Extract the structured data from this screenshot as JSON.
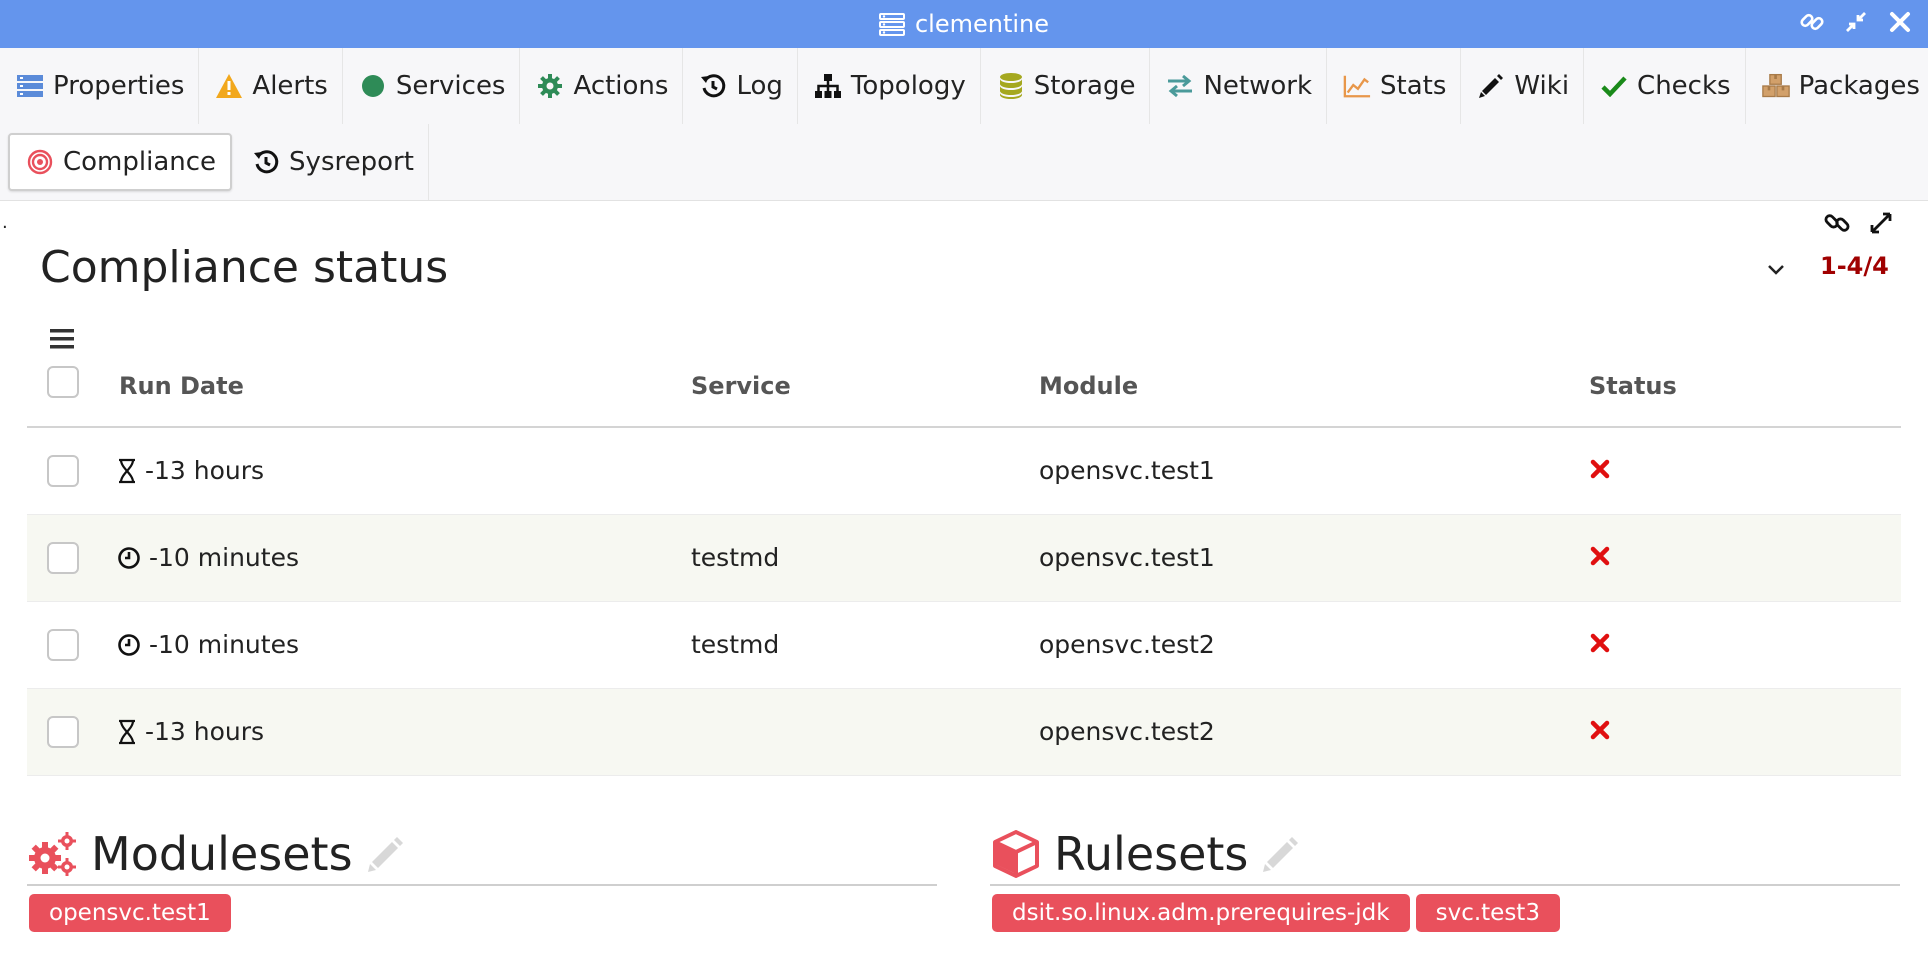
{
  "window": {
    "title": "clementine"
  },
  "tabs": [
    {
      "label": "Properties",
      "icon": "server-icon"
    },
    {
      "label": "Alerts",
      "icon": "warning-icon"
    },
    {
      "label": "Services",
      "icon": "circle-icon"
    },
    {
      "label": "Actions",
      "icon": "gear-icon"
    },
    {
      "label": "Log",
      "icon": "history-icon"
    },
    {
      "label": "Topology",
      "icon": "sitemap-icon"
    },
    {
      "label": "Storage",
      "icon": "database-icon"
    },
    {
      "label": "Network",
      "icon": "exchange-icon"
    },
    {
      "label": "Stats",
      "icon": "chart-icon"
    },
    {
      "label": "Wiki",
      "icon": "pencil-icon"
    },
    {
      "label": "Checks",
      "icon": "check-icon"
    },
    {
      "label": "Packages",
      "icon": "boxes-icon"
    },
    {
      "label": "Compliance",
      "icon": "target-icon",
      "active": true
    },
    {
      "label": "Sysreport",
      "icon": "history-icon"
    }
  ],
  "panel": {
    "marker": ".",
    "title": "Compliance status",
    "pager": "1-4/4"
  },
  "table": {
    "columns": [
      "Run Date",
      "Service",
      "Module",
      "Status"
    ],
    "rows": [
      {
        "run_date": "-13 hours",
        "date_icon": "hourglass-icon",
        "service": "",
        "module": "opensvc.test1",
        "status": "error"
      },
      {
        "run_date": "-10 minutes",
        "date_icon": "clock-icon",
        "service": "testmd",
        "module": "opensvc.test1",
        "status": "error"
      },
      {
        "run_date": "-10 minutes",
        "date_icon": "clock-icon",
        "service": "testmd",
        "module": "opensvc.test2",
        "status": "error"
      },
      {
        "run_date": "-13 hours",
        "date_icon": "hourglass-icon",
        "service": "",
        "module": "opensvc.test2",
        "status": "error"
      }
    ]
  },
  "modulesets": {
    "title": "Modulesets",
    "items": [
      "opensvc.test1"
    ]
  },
  "rulesets": {
    "title": "Rulesets",
    "items": [
      "dsit.so.linux.adm.prerequires-jdk",
      "svc.test3"
    ]
  },
  "colors": {
    "titlebar": "#6495ed",
    "tag": "#e9505c",
    "pager": "#a00000",
    "error": "#e01010",
    "section_icon": "#e9505c"
  }
}
